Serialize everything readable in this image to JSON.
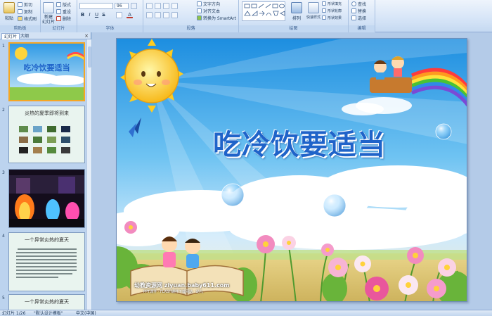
{
  "ribbon": {
    "clipboard": {
      "paste": "粘贴",
      "cut": "剪切",
      "copy": "复制",
      "format_painter": "格式刷",
      "label": "剪贴板"
    },
    "slides": {
      "new_slide": "新建\n幻灯片",
      "layout": "版式",
      "reset": "重设",
      "delete": "删除",
      "label": "幻灯片"
    },
    "font": {
      "font_size": "96",
      "label": "字体"
    },
    "paragraph": {
      "text_direction": "文字方向",
      "align_text": "对齐文本",
      "smartart": "转换为 SmartArt",
      "label": "段落"
    },
    "drawing": {
      "arrange": "排列",
      "quick_styles": "快速样式",
      "shape_fill": "形状填充",
      "shape_outline": "形状轮廓",
      "shape_effects": "形状效果",
      "label": "绘图"
    },
    "editing": {
      "find": "查找",
      "replace": "替换",
      "select": "选择",
      "label": "编辑"
    }
  },
  "panel": {
    "tab_slides": "幻灯片",
    "tab_outline": "大纲",
    "close": "×"
  },
  "thumbnails": [
    {
      "number": "1",
      "title": "吃冷饮要适当"
    },
    {
      "number": "2",
      "title": "炎热的夏季即将到来"
    },
    {
      "number": "3",
      "title": ""
    },
    {
      "number": "4",
      "title": "一个异常炎热的夏天"
    },
    {
      "number": "5",
      "title": "一个异常炎热的夏天"
    }
  ],
  "slide": {
    "title": "吃冷饮要适当",
    "watermark": "幼教资源网 ziyuan.baby611.com",
    "watermark_sub": "PPT课件 · FLASH课件下载网站  ·  幼儿"
  },
  "status": {
    "slide_count": "幻灯片 1/26",
    "theme": "\"默认设计模板\"",
    "language": "中文(中国)"
  },
  "colors": {
    "ribbon_bg": "#d6e5f7",
    "title_blue": "#1f63c9",
    "selected_border": "#f6a623",
    "sky_top": "#1d8ee0",
    "sky_bottom": "#cfeafb"
  }
}
